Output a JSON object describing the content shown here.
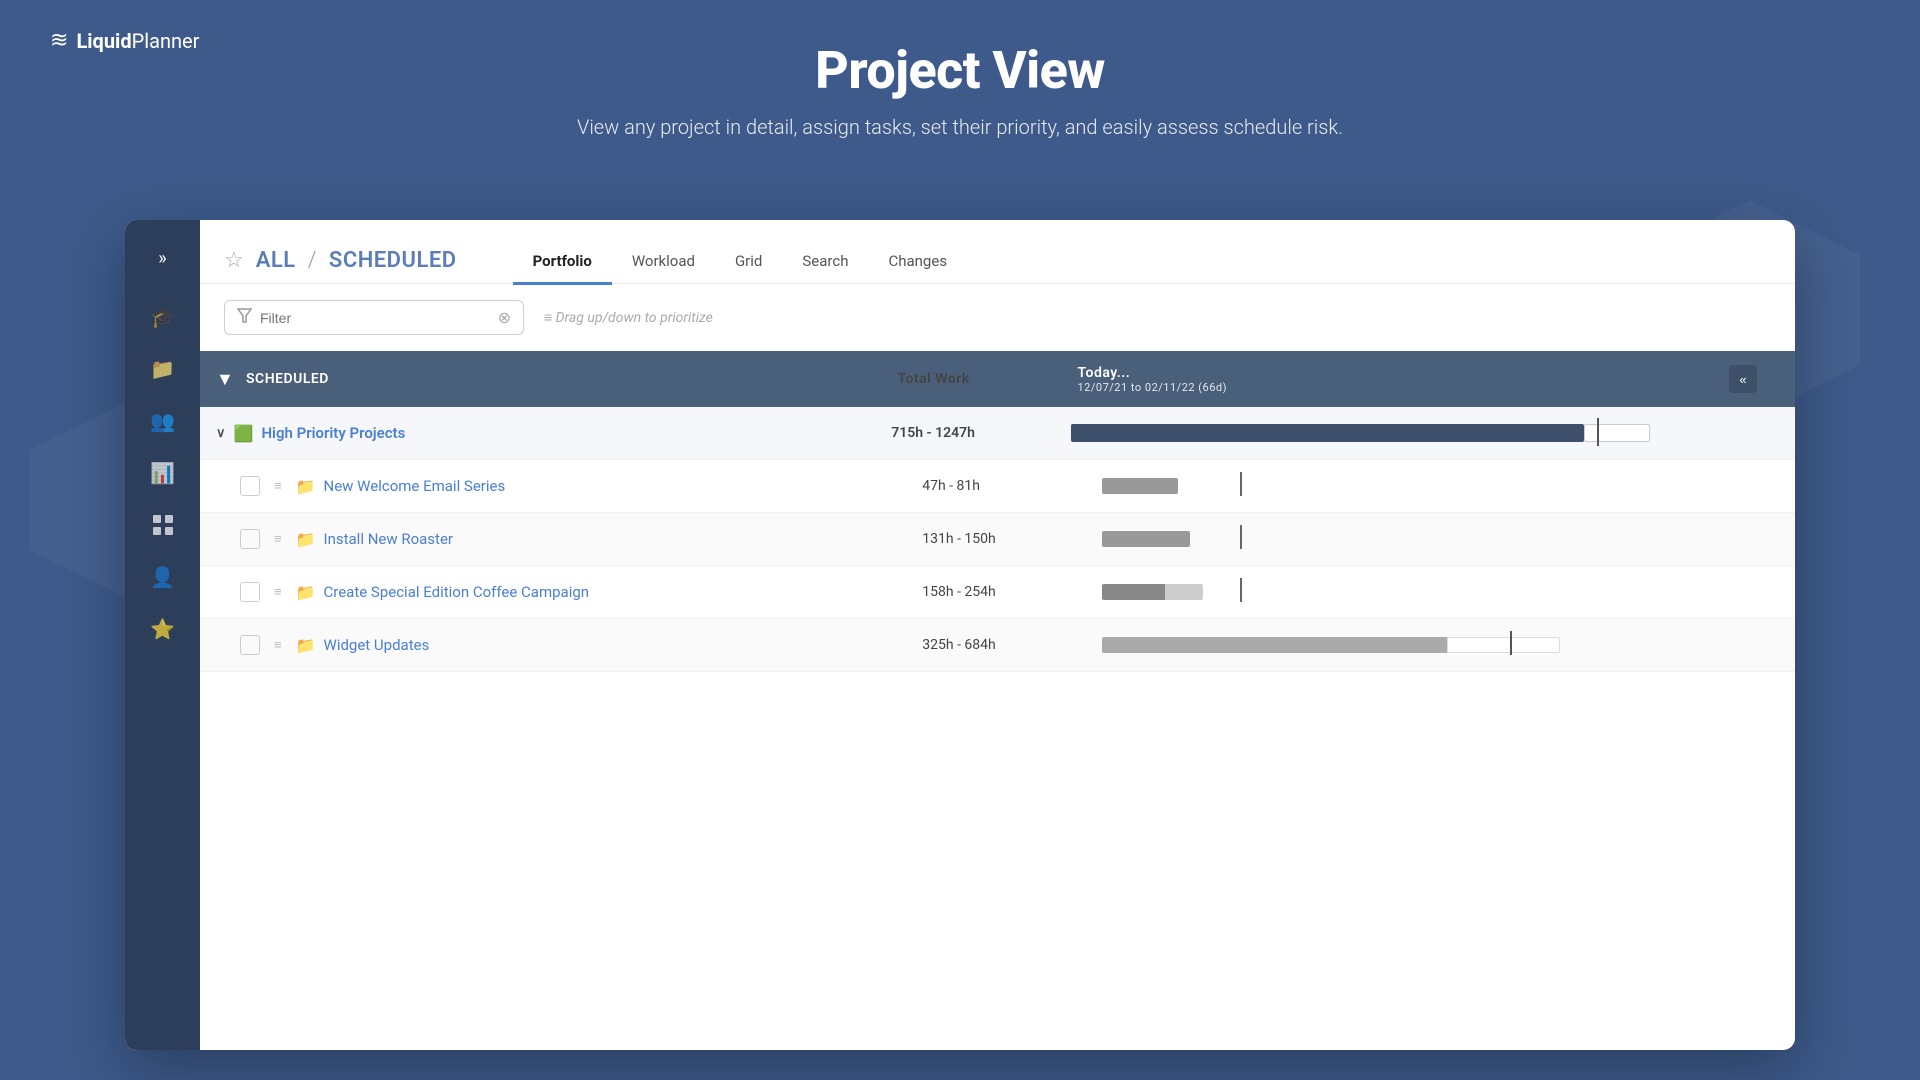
{
  "logo": {
    "waves": "≋",
    "text_bold": "Liquid",
    "text_regular": "Planner"
  },
  "header": {
    "title": "Project View",
    "subtitle": "View any project in detail, assign tasks, set their priority, and easily assess schedule risk."
  },
  "breadcrumb": {
    "part1": "ALL",
    "separator": "/",
    "part2": "SCHEDULED"
  },
  "tabs": [
    {
      "label": "Portfolio",
      "active": true
    },
    {
      "label": "Workload",
      "active": false
    },
    {
      "label": "Grid",
      "active": false
    },
    {
      "label": "Search",
      "active": false
    },
    {
      "label": "Changes",
      "active": false
    }
  ],
  "filter": {
    "placeholder": "Filter",
    "drag_hint": "Drag up/down to prioritize"
  },
  "table": {
    "header": {
      "group_label": "SCHEDULED",
      "work_label": "Total Work",
      "timeline_label": "Today...",
      "timeline_sub": "12/07/21 to 02/11/22 (66d)"
    },
    "rows": [
      {
        "type": "group",
        "name": "High Priority Projects",
        "work": "715h - 1247h",
        "bar_type": "group"
      },
      {
        "type": "project",
        "name": "New Welcome Email Series",
        "work": "47h - 81h",
        "bar_type": "small_gray",
        "icon_color": "#f0c040",
        "indent": true
      },
      {
        "type": "project",
        "name": "Install New Roaster",
        "work": "131h - 150h",
        "bar_type": "small_gray",
        "icon_color": "#e06060",
        "indent": true
      },
      {
        "type": "project",
        "name": "Create Special Edition Coffee Campaign",
        "work": "158h - 254h",
        "bar_type": "small_split",
        "icon_color": "#50c0a0",
        "indent": true
      },
      {
        "type": "project",
        "name": "Widget Updates",
        "work": "325h - 684h",
        "bar_type": "large_white_end",
        "icon_color": "#9070d0",
        "indent": false
      }
    ]
  },
  "sidebar": {
    "chevron": "»",
    "icons": [
      {
        "name": "graduation-cap-icon",
        "symbol": "🎓"
      },
      {
        "name": "folder-icon",
        "symbol": "📁"
      },
      {
        "name": "team-icon",
        "symbol": "👥"
      },
      {
        "name": "chart-icon",
        "symbol": "📊"
      },
      {
        "name": "grid-icon",
        "symbol": "⊞"
      },
      {
        "name": "person-icon",
        "symbol": "👤"
      },
      {
        "name": "star-icon",
        "symbol": "⭐"
      }
    ]
  },
  "colors": {
    "brand_blue": "#3d5a8a",
    "sidebar_dark": "#2d3e5a",
    "link_blue": "#4a7fd4",
    "bar_dark": "#3d4f6a"
  }
}
